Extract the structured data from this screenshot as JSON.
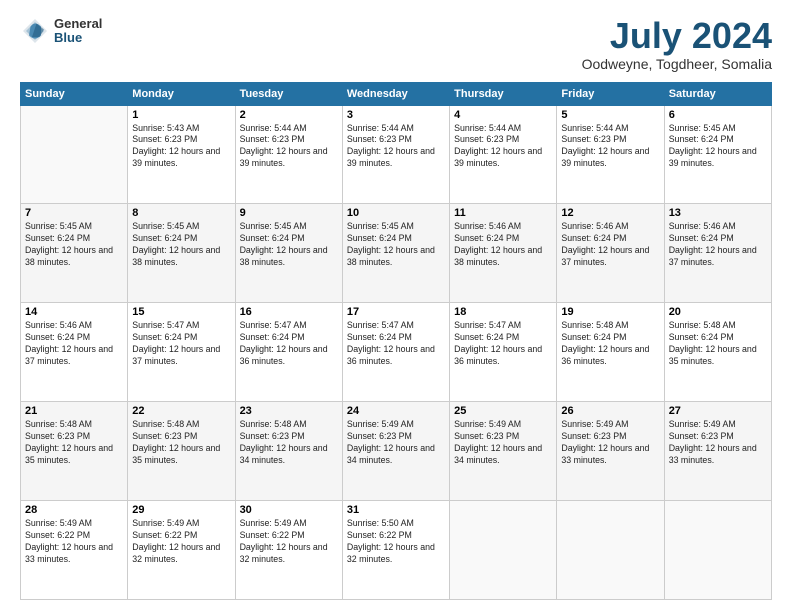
{
  "logo": {
    "general": "General",
    "blue": "Blue"
  },
  "title": "July 2024",
  "subtitle": "Oodweyne, Togdheer, Somalia",
  "days_of_week": [
    "Sunday",
    "Monday",
    "Tuesday",
    "Wednesday",
    "Thursday",
    "Friday",
    "Saturday"
  ],
  "weeks": [
    [
      {
        "day": "",
        "info": ""
      },
      {
        "day": "1",
        "info": "Sunrise: 5:43 AM\nSunset: 6:23 PM\nDaylight: 12 hours\nand 39 minutes."
      },
      {
        "day": "2",
        "info": "Sunrise: 5:44 AM\nSunset: 6:23 PM\nDaylight: 12 hours\nand 39 minutes."
      },
      {
        "day": "3",
        "info": "Sunrise: 5:44 AM\nSunset: 6:23 PM\nDaylight: 12 hours\nand 39 minutes."
      },
      {
        "day": "4",
        "info": "Sunrise: 5:44 AM\nSunset: 6:23 PM\nDaylight: 12 hours\nand 39 minutes."
      },
      {
        "day": "5",
        "info": "Sunrise: 5:44 AM\nSunset: 6:23 PM\nDaylight: 12 hours\nand 39 minutes."
      },
      {
        "day": "6",
        "info": "Sunrise: 5:45 AM\nSunset: 6:24 PM\nDaylight: 12 hours\nand 39 minutes."
      }
    ],
    [
      {
        "day": "7",
        "info": "Sunrise: 5:45 AM\nSunset: 6:24 PM\nDaylight: 12 hours\nand 38 minutes."
      },
      {
        "day": "8",
        "info": "Sunrise: 5:45 AM\nSunset: 6:24 PM\nDaylight: 12 hours\nand 38 minutes."
      },
      {
        "day": "9",
        "info": "Sunrise: 5:45 AM\nSunset: 6:24 PM\nDaylight: 12 hours\nand 38 minutes."
      },
      {
        "day": "10",
        "info": "Sunrise: 5:45 AM\nSunset: 6:24 PM\nDaylight: 12 hours\nand 38 minutes."
      },
      {
        "day": "11",
        "info": "Sunrise: 5:46 AM\nSunset: 6:24 PM\nDaylight: 12 hours\nand 38 minutes."
      },
      {
        "day": "12",
        "info": "Sunrise: 5:46 AM\nSunset: 6:24 PM\nDaylight: 12 hours\nand 37 minutes."
      },
      {
        "day": "13",
        "info": "Sunrise: 5:46 AM\nSunset: 6:24 PM\nDaylight: 12 hours\nand 37 minutes."
      }
    ],
    [
      {
        "day": "14",
        "info": "Sunrise: 5:46 AM\nSunset: 6:24 PM\nDaylight: 12 hours\nand 37 minutes."
      },
      {
        "day": "15",
        "info": "Sunrise: 5:47 AM\nSunset: 6:24 PM\nDaylight: 12 hours\nand 37 minutes."
      },
      {
        "day": "16",
        "info": "Sunrise: 5:47 AM\nSunset: 6:24 PM\nDaylight: 12 hours\nand 36 minutes."
      },
      {
        "day": "17",
        "info": "Sunrise: 5:47 AM\nSunset: 6:24 PM\nDaylight: 12 hours\nand 36 minutes."
      },
      {
        "day": "18",
        "info": "Sunrise: 5:47 AM\nSunset: 6:24 PM\nDaylight: 12 hours\nand 36 minutes."
      },
      {
        "day": "19",
        "info": "Sunrise: 5:48 AM\nSunset: 6:24 PM\nDaylight: 12 hours\nand 36 minutes."
      },
      {
        "day": "20",
        "info": "Sunrise: 5:48 AM\nSunset: 6:24 PM\nDaylight: 12 hours\nand 35 minutes."
      }
    ],
    [
      {
        "day": "21",
        "info": "Sunrise: 5:48 AM\nSunset: 6:23 PM\nDaylight: 12 hours\nand 35 minutes."
      },
      {
        "day": "22",
        "info": "Sunrise: 5:48 AM\nSunset: 6:23 PM\nDaylight: 12 hours\nand 35 minutes."
      },
      {
        "day": "23",
        "info": "Sunrise: 5:48 AM\nSunset: 6:23 PM\nDaylight: 12 hours\nand 34 minutes."
      },
      {
        "day": "24",
        "info": "Sunrise: 5:49 AM\nSunset: 6:23 PM\nDaylight: 12 hours\nand 34 minutes."
      },
      {
        "day": "25",
        "info": "Sunrise: 5:49 AM\nSunset: 6:23 PM\nDaylight: 12 hours\nand 34 minutes."
      },
      {
        "day": "26",
        "info": "Sunrise: 5:49 AM\nSunset: 6:23 PM\nDaylight: 12 hours\nand 33 minutes."
      },
      {
        "day": "27",
        "info": "Sunrise: 5:49 AM\nSunset: 6:23 PM\nDaylight: 12 hours\nand 33 minutes."
      }
    ],
    [
      {
        "day": "28",
        "info": "Sunrise: 5:49 AM\nSunset: 6:22 PM\nDaylight: 12 hours\nand 33 minutes."
      },
      {
        "day": "29",
        "info": "Sunrise: 5:49 AM\nSunset: 6:22 PM\nDaylight: 12 hours\nand 32 minutes."
      },
      {
        "day": "30",
        "info": "Sunrise: 5:49 AM\nSunset: 6:22 PM\nDaylight: 12 hours\nand 32 minutes."
      },
      {
        "day": "31",
        "info": "Sunrise: 5:50 AM\nSunset: 6:22 PM\nDaylight: 12 hours\nand 32 minutes."
      },
      {
        "day": "",
        "info": ""
      },
      {
        "day": "",
        "info": ""
      },
      {
        "day": "",
        "info": ""
      }
    ]
  ]
}
